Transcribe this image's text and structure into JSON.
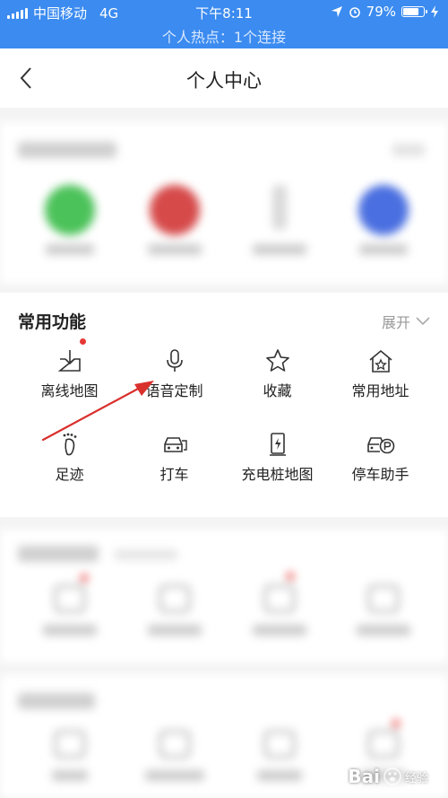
{
  "status_bar": {
    "carrier": "中国移动",
    "network": "4G",
    "time": "下午8:11",
    "battery_text": "79%",
    "battery_level": 0.79,
    "hotspot": "个人热点：1个连接",
    "bg_color": "#3b8bf0"
  },
  "header": {
    "title": "个人中心",
    "back_icon": "chevron-left-icon"
  },
  "common_functions": {
    "title": "常用功能",
    "expand_label": "展开",
    "items": [
      {
        "label": "离线地图",
        "icon": "offline-map-icon",
        "badge": true
      },
      {
        "label": "语音定制",
        "icon": "microphone-icon",
        "badge": false
      },
      {
        "label": "收藏",
        "icon": "star-icon",
        "badge": false
      },
      {
        "label": "常用地址",
        "icon": "home-star-icon",
        "badge": false
      },
      {
        "label": "足迹",
        "icon": "footprint-icon",
        "badge": false
      },
      {
        "label": "打车",
        "icon": "taxi-icon",
        "badge": false
      },
      {
        "label": "充电桩地图",
        "icon": "charging-pile-icon",
        "badge": false
      },
      {
        "label": "停车助手",
        "icon": "parking-car-icon",
        "badge": false
      }
    ]
  },
  "annotation": {
    "arrow_color": "#d9302c"
  },
  "watermark": {
    "logo": "Bai",
    "text": "经验"
  }
}
